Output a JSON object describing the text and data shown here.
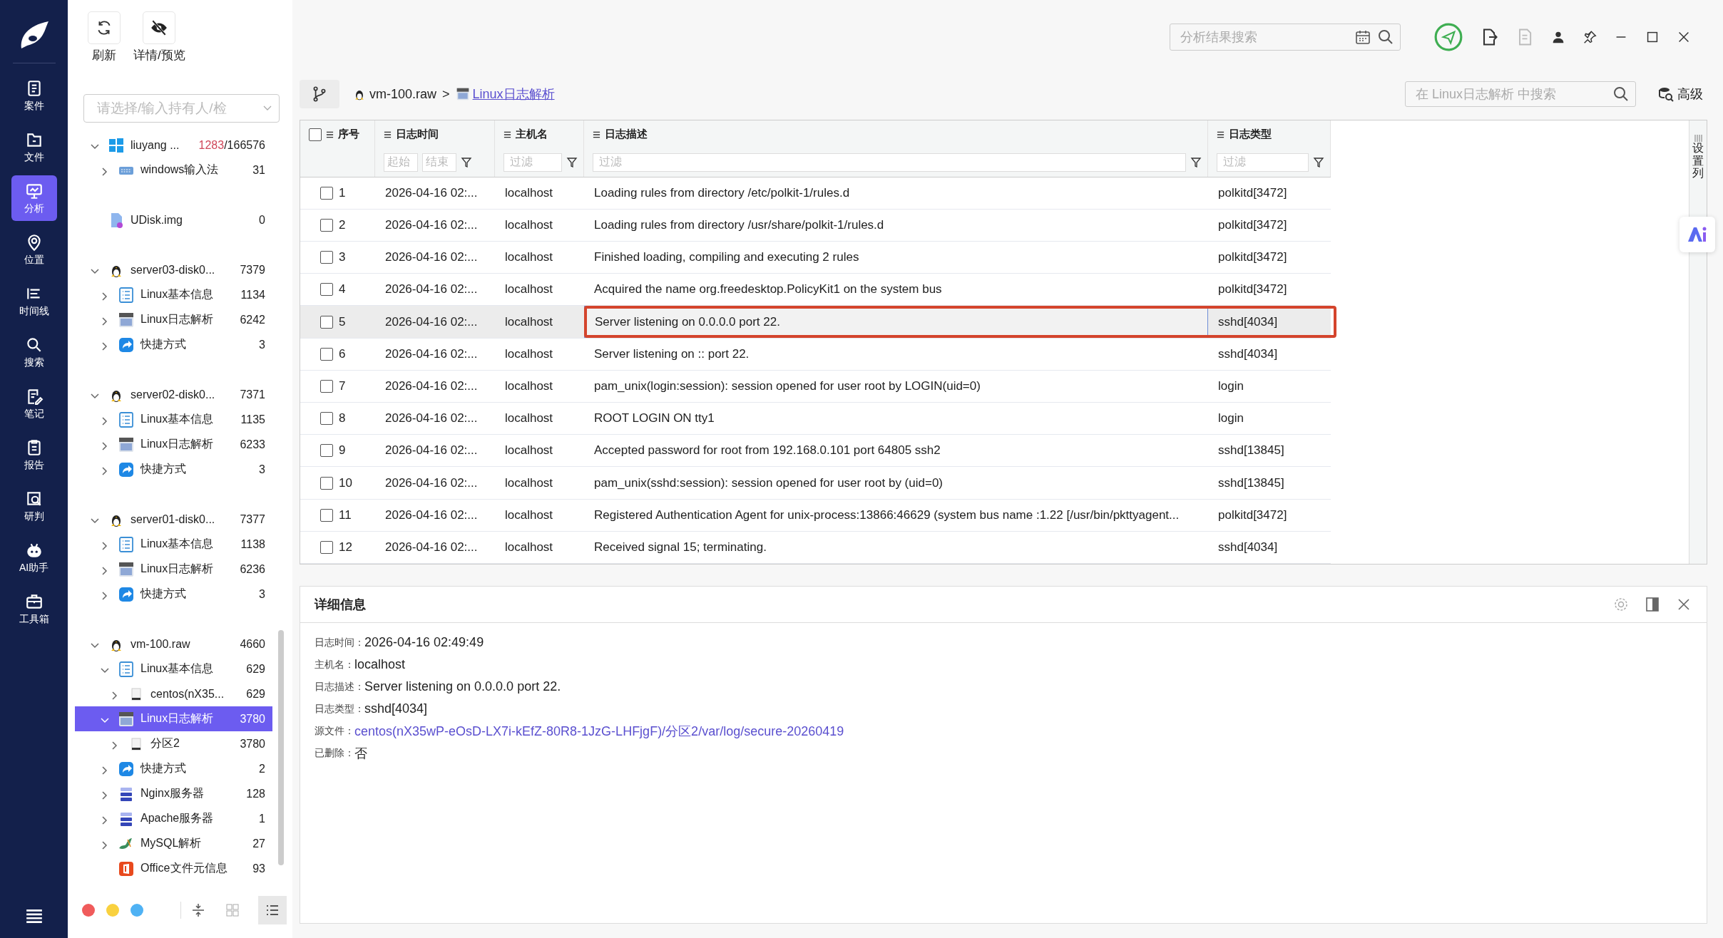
{
  "toolbar": [
    {
      "label": "刷新",
      "kind": "refresh"
    },
    {
      "label": "详情/预览",
      "kind": "hide"
    }
  ],
  "nav": [
    {
      "label": "案件",
      "kind": "case",
      "selected": false
    },
    {
      "label": "文件",
      "kind": "folder",
      "selected": false
    },
    {
      "label": "分析",
      "kind": "analysis",
      "selected": true
    },
    {
      "label": "位置",
      "kind": "location",
      "selected": false
    },
    {
      "label": "时间线",
      "kind": "timeline",
      "selected": false
    },
    {
      "label": "搜索",
      "kind": "search",
      "selected": false
    },
    {
      "label": "笔记",
      "kind": "note",
      "selected": false
    },
    {
      "label": "报告",
      "kind": "report",
      "selected": false
    },
    {
      "label": "研判",
      "kind": "judge",
      "selected": false
    },
    {
      "label": "AI助手",
      "kind": "robot",
      "selected": false
    },
    {
      "label": "工具箱",
      "kind": "toolbox",
      "selected": false
    }
  ],
  "tree": {
    "placeholder": "请选择/输入持有人/检",
    "nodes": [
      {
        "label": "liuyang ...",
        "kind": "windows",
        "hits": "1283",
        "count": "/166576",
        "expanded": true,
        "selected": false,
        "children": [
          {
            "label": "windows输入法",
            "kind": "keyboard",
            "count": "31",
            "expanded": false,
            "selected": false
          }
        ]
      },
      {
        "label": "UDisk.img",
        "kind": "file",
        "count": "0",
        "selected": false
      },
      {
        "label": "server03-disk0...",
        "kind": "linux",
        "count": "7379",
        "expanded": true,
        "selected": false,
        "children": [
          {
            "label": "Linux基本信息",
            "kind": "list",
            "count": "1134",
            "expanded": false,
            "selected": false
          },
          {
            "label": "Linux日志解析",
            "kind": "log",
            "count": "6242",
            "expanded": false,
            "selected": false
          },
          {
            "label": "快捷方式",
            "kind": "shortcut",
            "count": "3",
            "expanded": false,
            "selected": false
          }
        ]
      },
      {
        "label": "server02-disk0...",
        "kind": "linux",
        "count": "7371",
        "expanded": true,
        "selected": false,
        "children": [
          {
            "label": "Linux基本信息",
            "kind": "list",
            "count": "1135",
            "expanded": false,
            "selected": false
          },
          {
            "label": "Linux日志解析",
            "kind": "log",
            "count": "6233",
            "expanded": false,
            "selected": false
          },
          {
            "label": "快捷方式",
            "kind": "shortcut",
            "count": "3",
            "expanded": false,
            "selected": false
          }
        ]
      },
      {
        "label": "server01-disk0...",
        "kind": "linux",
        "count": "7377",
        "expanded": true,
        "selected": false,
        "children": [
          {
            "label": "Linux基本信息",
            "kind": "list",
            "count": "1138",
            "expanded": false,
            "selected": false
          },
          {
            "label": "Linux日志解析",
            "kind": "log",
            "count": "6236",
            "expanded": false,
            "selected": false
          },
          {
            "label": "快捷方式",
            "kind": "shortcut",
            "count": "3",
            "expanded": false,
            "selected": false
          }
        ]
      },
      {
        "label": "vm-100.raw",
        "kind": "linux",
        "count": "4660",
        "expanded": true,
        "selected": false,
        "children": [
          {
            "label": "Linux基本信息",
            "kind": "list",
            "count": "629",
            "expanded": true,
            "selected": false,
            "children": [
              {
                "label": "centos(nX35...",
                "kind": "disk",
                "count": "629",
                "expanded": false,
                "selected": false
              }
            ]
          },
          {
            "label": "Linux日志解析",
            "kind": "log",
            "count": "3780",
            "expanded": true,
            "selected": true,
            "children": [
              {
                "label": "分区2",
                "kind": "disk",
                "count": "3780",
                "expanded": false,
                "selected": false
              }
            ]
          },
          {
            "label": "快捷方式",
            "kind": "shortcut",
            "count": "2",
            "expanded": false,
            "selected": false
          },
          {
            "label": "Nginx服务器",
            "kind": "server",
            "count": "128",
            "expanded": false,
            "selected": false
          },
          {
            "label": "Apache服务器",
            "kind": "server",
            "count": "1",
            "expanded": false,
            "selected": false
          },
          {
            "label": "MySQL解析",
            "kind": "mysql",
            "count": "27",
            "expanded": false,
            "selected": false
          },
          {
            "label": "Office文件元信息",
            "kind": "office",
            "count": "93",
            "selected": false
          }
        ]
      }
    ]
  },
  "tree_footer": {
    "dots": [
      {
        "color": "#f05b5b"
      },
      {
        "color": "#f9d13f"
      },
      {
        "color": "#4fb2f4"
      }
    ],
    "views": [
      {
        "kind": "grid",
        "selected": false
      },
      {
        "kind": "list",
        "selected": true
      }
    ]
  },
  "search": {
    "placeholder": "分析结果搜索"
  },
  "breadcrumb": {
    "items": [
      {
        "label": "vm-100.raw",
        "kind": "linux",
        "link": false
      },
      {
        "label": "Linux日志解析",
        "kind": "log",
        "link": true
      }
    ],
    "separator": ">"
  },
  "table_search": {
    "placeholder": "在 Linux日志解析 中搜索"
  },
  "advanced": "高级",
  "table": {
    "all_checked": false,
    "column_settings": "设置列",
    "columns": [
      {
        "label": "序号"
      },
      {
        "label": "日志时间",
        "filters": [
          "起始",
          "结束"
        ]
      },
      {
        "label": "主机名",
        "filters": [
          "过滤"
        ]
      },
      {
        "label": "日志描述",
        "filters": [
          "过滤"
        ]
      },
      {
        "label": "日志类型",
        "filters": [
          "过滤"
        ]
      }
    ],
    "rows": [
      {
        "index": "1",
        "checked": false,
        "time": "2026-04-16 02:...",
        "host": "localhost",
        "desc": "Loading rules from directory /etc/polkit-1/rules.d",
        "type": "polkitd[3472]",
        "selected": false,
        "marked": false
      },
      {
        "index": "2",
        "checked": false,
        "time": "2026-04-16 02:...",
        "host": "localhost",
        "desc": "Loading rules from directory /usr/share/polkit-1/rules.d",
        "type": "polkitd[3472]",
        "selected": false,
        "marked": false
      },
      {
        "index": "3",
        "checked": false,
        "time": "2026-04-16 02:...",
        "host": "localhost",
        "desc": "Finished loading, compiling and executing 2 rules",
        "type": "polkitd[3472]",
        "selected": false,
        "marked": false
      },
      {
        "index": "4",
        "checked": false,
        "time": "2026-04-16 02:...",
        "host": "localhost",
        "desc": "Acquired the name org.freedesktop.PolicyKit1 on the system bus",
        "type": "polkitd[3472]",
        "selected": false,
        "marked": false
      },
      {
        "index": "5",
        "checked": false,
        "time": "2026-04-16 02:...",
        "host": "localhost",
        "desc": "Server listening on 0.0.0.0 port 22.",
        "type": "sshd[4034]",
        "selected": true,
        "marked": true
      },
      {
        "index": "6",
        "checked": false,
        "time": "2026-04-16 02:...",
        "host": "localhost",
        "desc": "Server listening on :: port 22.",
        "type": "sshd[4034]",
        "selected": false,
        "marked": false
      },
      {
        "index": "7",
        "checked": false,
        "time": "2026-04-16 02:...",
        "host": "localhost",
        "desc": "pam_unix(login:session): session opened for user root by LOGIN(uid=0)",
        "type": "login",
        "selected": false,
        "marked": false
      },
      {
        "index": "8",
        "checked": false,
        "time": "2026-04-16 02:...",
        "host": "localhost",
        "desc": "ROOT LOGIN ON tty1",
        "type": "login",
        "selected": false,
        "marked": false
      },
      {
        "index": "9",
        "checked": false,
        "time": "2026-04-16 02:...",
        "host": "localhost",
        "desc": "Accepted password for root from 192.168.0.101 port 64805 ssh2",
        "type": "sshd[13845]",
        "selected": false,
        "marked": false
      },
      {
        "index": "10",
        "checked": false,
        "time": "2026-04-16 02:...",
        "host": "localhost",
        "desc": "pam_unix(sshd:session): session opened for user root by (uid=0)",
        "type": "sshd[13845]",
        "selected": false,
        "marked": false
      },
      {
        "index": "11",
        "checked": false,
        "time": "2026-04-16 02:...",
        "host": "localhost",
        "desc": "Registered Authentication Agent for unix-process:13866:46629 (system bus name :1.22 [/usr/bin/pkttyagent...",
        "type": "polkitd[3472]",
        "selected": false,
        "marked": false
      },
      {
        "index": "12",
        "checked": false,
        "time": "2026-04-16 02:...",
        "host": "localhost",
        "desc": "Received signal 15; terminating.",
        "type": "sshd[4034]",
        "selected": false,
        "marked": false
      }
    ]
  },
  "details": {
    "title": "详细信息",
    "fields": [
      {
        "label": "日志时间：",
        "value": "2026-04-16 02:49:49",
        "kind": "text"
      },
      {
        "label": "主机名：",
        "value": "localhost",
        "kind": "text"
      },
      {
        "label": "日志描述：",
        "value": "Server listening on 0.0.0.0 port 22.",
        "kind": "text"
      },
      {
        "label": "日志类型：",
        "value": "sshd[4034]",
        "kind": "text"
      },
      {
        "label": "源文件：",
        "value": "centos(nX35wP-eOsD-LX7i-kEfZ-80R8-1JzG-LHFjgF)/分区2/var/log/secure-20260419",
        "kind": "link"
      },
      {
        "label": "已删除：",
        "value": "否",
        "kind": "text"
      }
    ]
  }
}
